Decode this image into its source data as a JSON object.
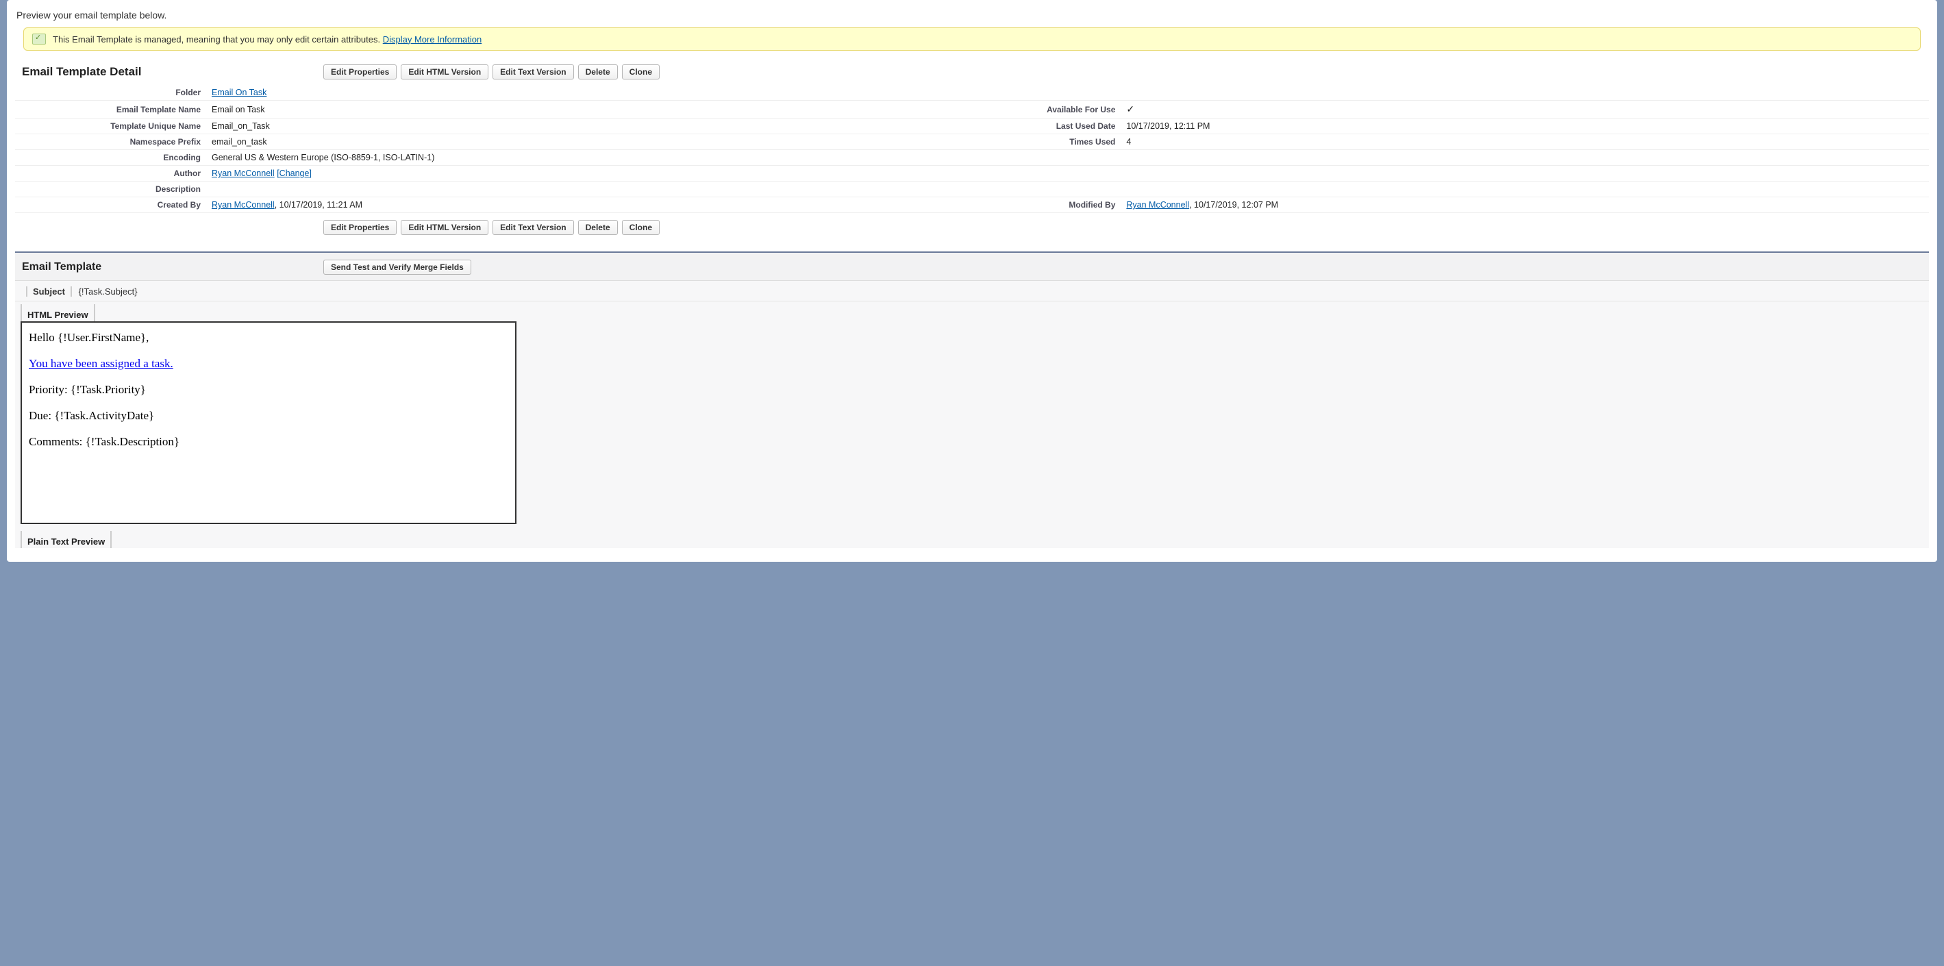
{
  "intro": "Preview your email template below.",
  "banner": {
    "text": "This Email Template is managed, meaning that you may only edit certain attributes. ",
    "link": "Display More Information"
  },
  "detail": {
    "title": "Email Template Detail",
    "buttons": {
      "edit_properties": "Edit Properties",
      "edit_html": "Edit HTML Version",
      "edit_text": "Edit Text Version",
      "delete": "Delete",
      "clone": "Clone"
    },
    "fields": {
      "folder_label": "Folder",
      "folder_value": "Email On Task",
      "name_label": "Email Template Name",
      "name_value": "Email on Task",
      "available_label": "Available For Use",
      "unique_label": "Template Unique Name",
      "unique_value": "Email_on_Task",
      "last_used_label": "Last Used Date",
      "last_used_value": "10/17/2019, 12:11 PM",
      "namespace_label": "Namespace Prefix",
      "namespace_value": "email_on_task",
      "times_used_label": "Times Used",
      "times_used_value": "4",
      "encoding_label": "Encoding",
      "encoding_value": "General US & Western Europe (ISO-8859-1, ISO-LATIN-1)",
      "author_label": "Author",
      "author_value": "Ryan McConnell",
      "author_change": "[Change]",
      "description_label": "Description",
      "created_by_label": "Created By",
      "created_by_name": "Ryan McConnell",
      "created_by_suffix": ", 10/17/2019, 11:21 AM",
      "modified_by_label": "Modified By",
      "modified_by_name": "Ryan McConnell",
      "modified_by_suffix": ", 10/17/2019, 12:07 PM"
    }
  },
  "template": {
    "title": "Email Template",
    "send_test_btn": "Send Test and Verify Merge Fields",
    "subject_label": "Subject",
    "subject_value": "{!Task.Subject}",
    "html_preview_label": "HTML Preview",
    "plain_text_label": "Plain Text Preview",
    "body": {
      "greeting": "Hello {!User.FirstName},",
      "link": "You have been assigned a task.",
      "priority": "Priority: {!Task.Priority}",
      "due": "Due: {!Task.ActivityDate}",
      "comments": "Comments: {!Task.Description}"
    }
  }
}
